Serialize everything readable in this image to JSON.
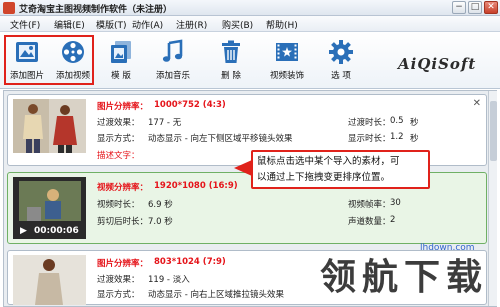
{
  "window": {
    "title": "艾奇淘宝主图视频制作软件（未注册）",
    "controls": {
      "minimize": "−",
      "maximize": "□",
      "close": "✕"
    }
  },
  "menu": [
    {
      "label": "文件(F)"
    },
    {
      "label": "编辑(E)"
    },
    {
      "label": "模版(T)"
    },
    {
      "label": "动作(A)"
    },
    {
      "label": "注册(R)"
    },
    {
      "label": "购买(B)"
    },
    {
      "label": "帮助(H)"
    }
  ],
  "toolbar": {
    "add_image": "添加图片",
    "add_video": "添加视频",
    "template": "模 版",
    "add_music": "添加音乐",
    "delete": "删 除",
    "video_decor": "视频装饰",
    "options": "选 项"
  },
  "brand": "AiQiSoft",
  "items": [
    {
      "header_label": "图片分辨率：",
      "header_value": "1000*752 (4:3)",
      "row1_left_label": "过渡效果：",
      "row1_left_value": "177 - 无",
      "row1_right_label": "过渡时长：",
      "row1_right_value": "0.5",
      "row1_right_unit": "秒",
      "row2_left_label": "显示方式：",
      "row2_left_value": "动态显示 - 向左下侧区域平移镜头效果",
      "row2_right_label": "显示时长：",
      "row2_right_value": "1.2",
      "row2_right_unit": "秒",
      "row3_label": "描述文字：",
      "close": "✕"
    },
    {
      "header_label": "视频分辨率：",
      "header_value": "1920*1080 (16:9)",
      "row1_left_label": "视频时长：",
      "row1_left_value": "6.9 秒",
      "row1_right_label": "视频帧率：",
      "row1_right_value": "30",
      "row2_left_label": "剪切后时长：",
      "row2_left_value": "7.0 秒",
      "row2_right_label": "声道数量：",
      "row2_right_value": "2",
      "timecode": "00:00:06"
    },
    {
      "header_label": "图片分辨率：",
      "header_value": "803*1024 (7:9)",
      "row1_left_label": "过渡效果：",
      "row1_left_value": "119 - 淡入",
      "row2_left_label": "显示方式：",
      "row2_left_value": "动态显示 - 向右上区域推拉镜头效果"
    }
  ],
  "tooltip": {
    "line1": "鼠标点击选中某个导入的素材，可",
    "line2": "以通过上下拖拽变更排序位置。"
  },
  "watermark": {
    "text": "领航下载",
    "site": "lhdown.com"
  },
  "colors": {
    "accent_red": "#e0221b",
    "selected_bg": "#e9f5e6",
    "toolbar_blue": "#2a6fb8"
  }
}
